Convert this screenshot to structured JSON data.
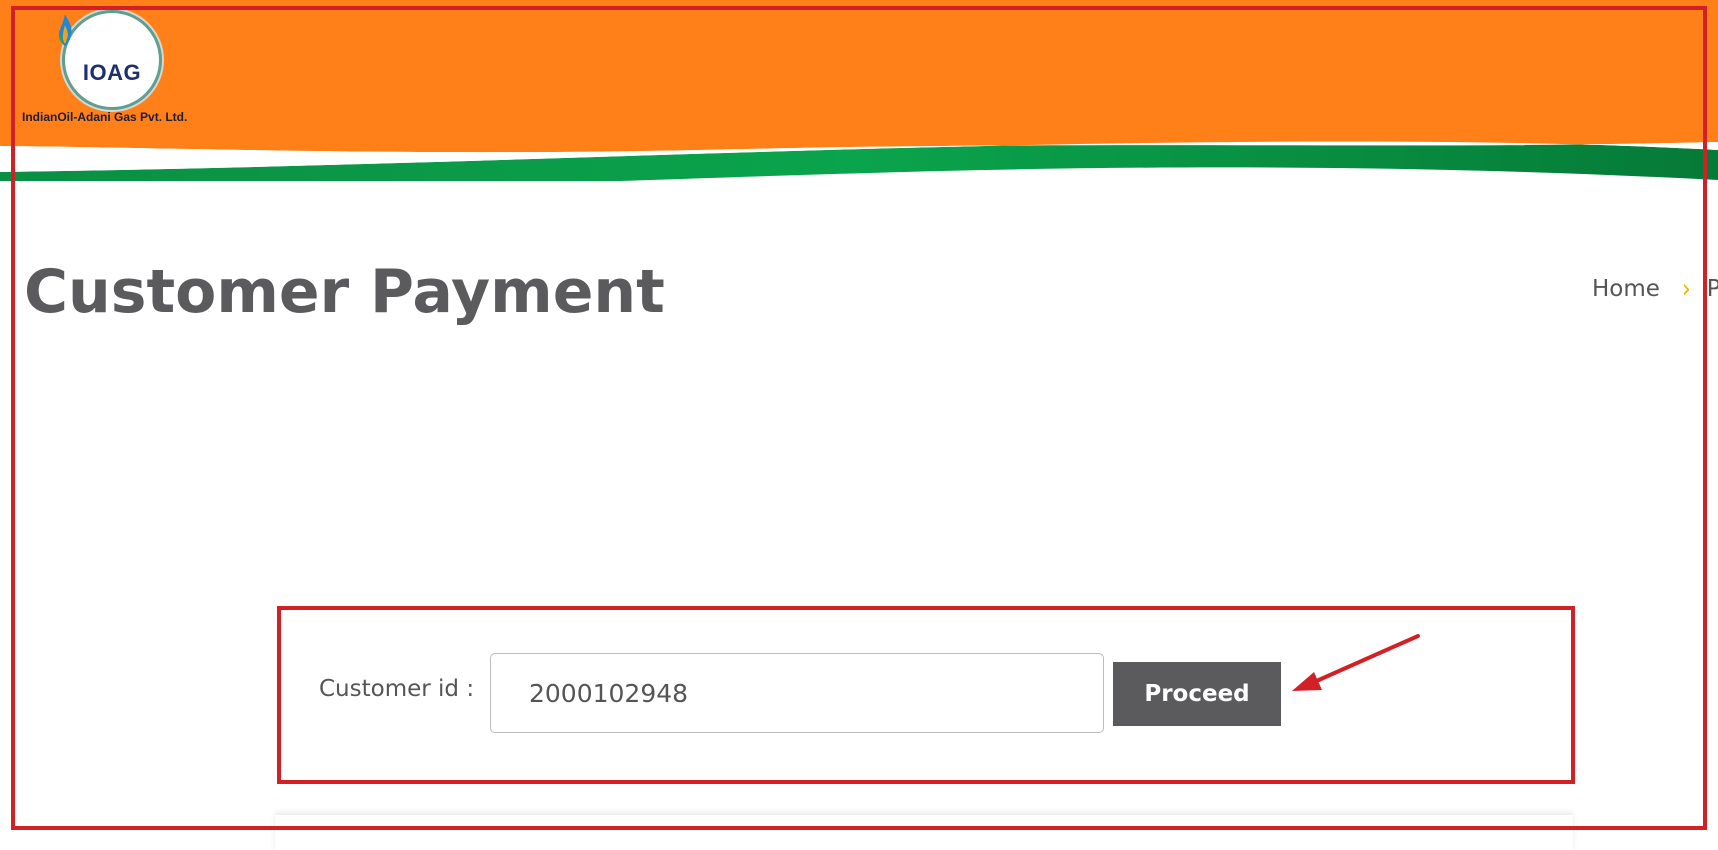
{
  "header": {
    "logo_text": "IOAG",
    "company_name": "IndianOil-Adani Gas Pvt. Ltd.",
    "colors": {
      "orange": "#ff7f19",
      "green": "#0a9e48",
      "logo_text": "#1d2f6f"
    }
  },
  "page": {
    "title": "Customer Payment"
  },
  "breadcrumb": {
    "home_label": "Home",
    "separator_icon": "chevron-right-icon",
    "current_label": "P"
  },
  "form": {
    "label": "Customer id :",
    "input_value": "2000102948",
    "proceed_label": "Proceed"
  },
  "annotation": {
    "color": "#d22027"
  }
}
